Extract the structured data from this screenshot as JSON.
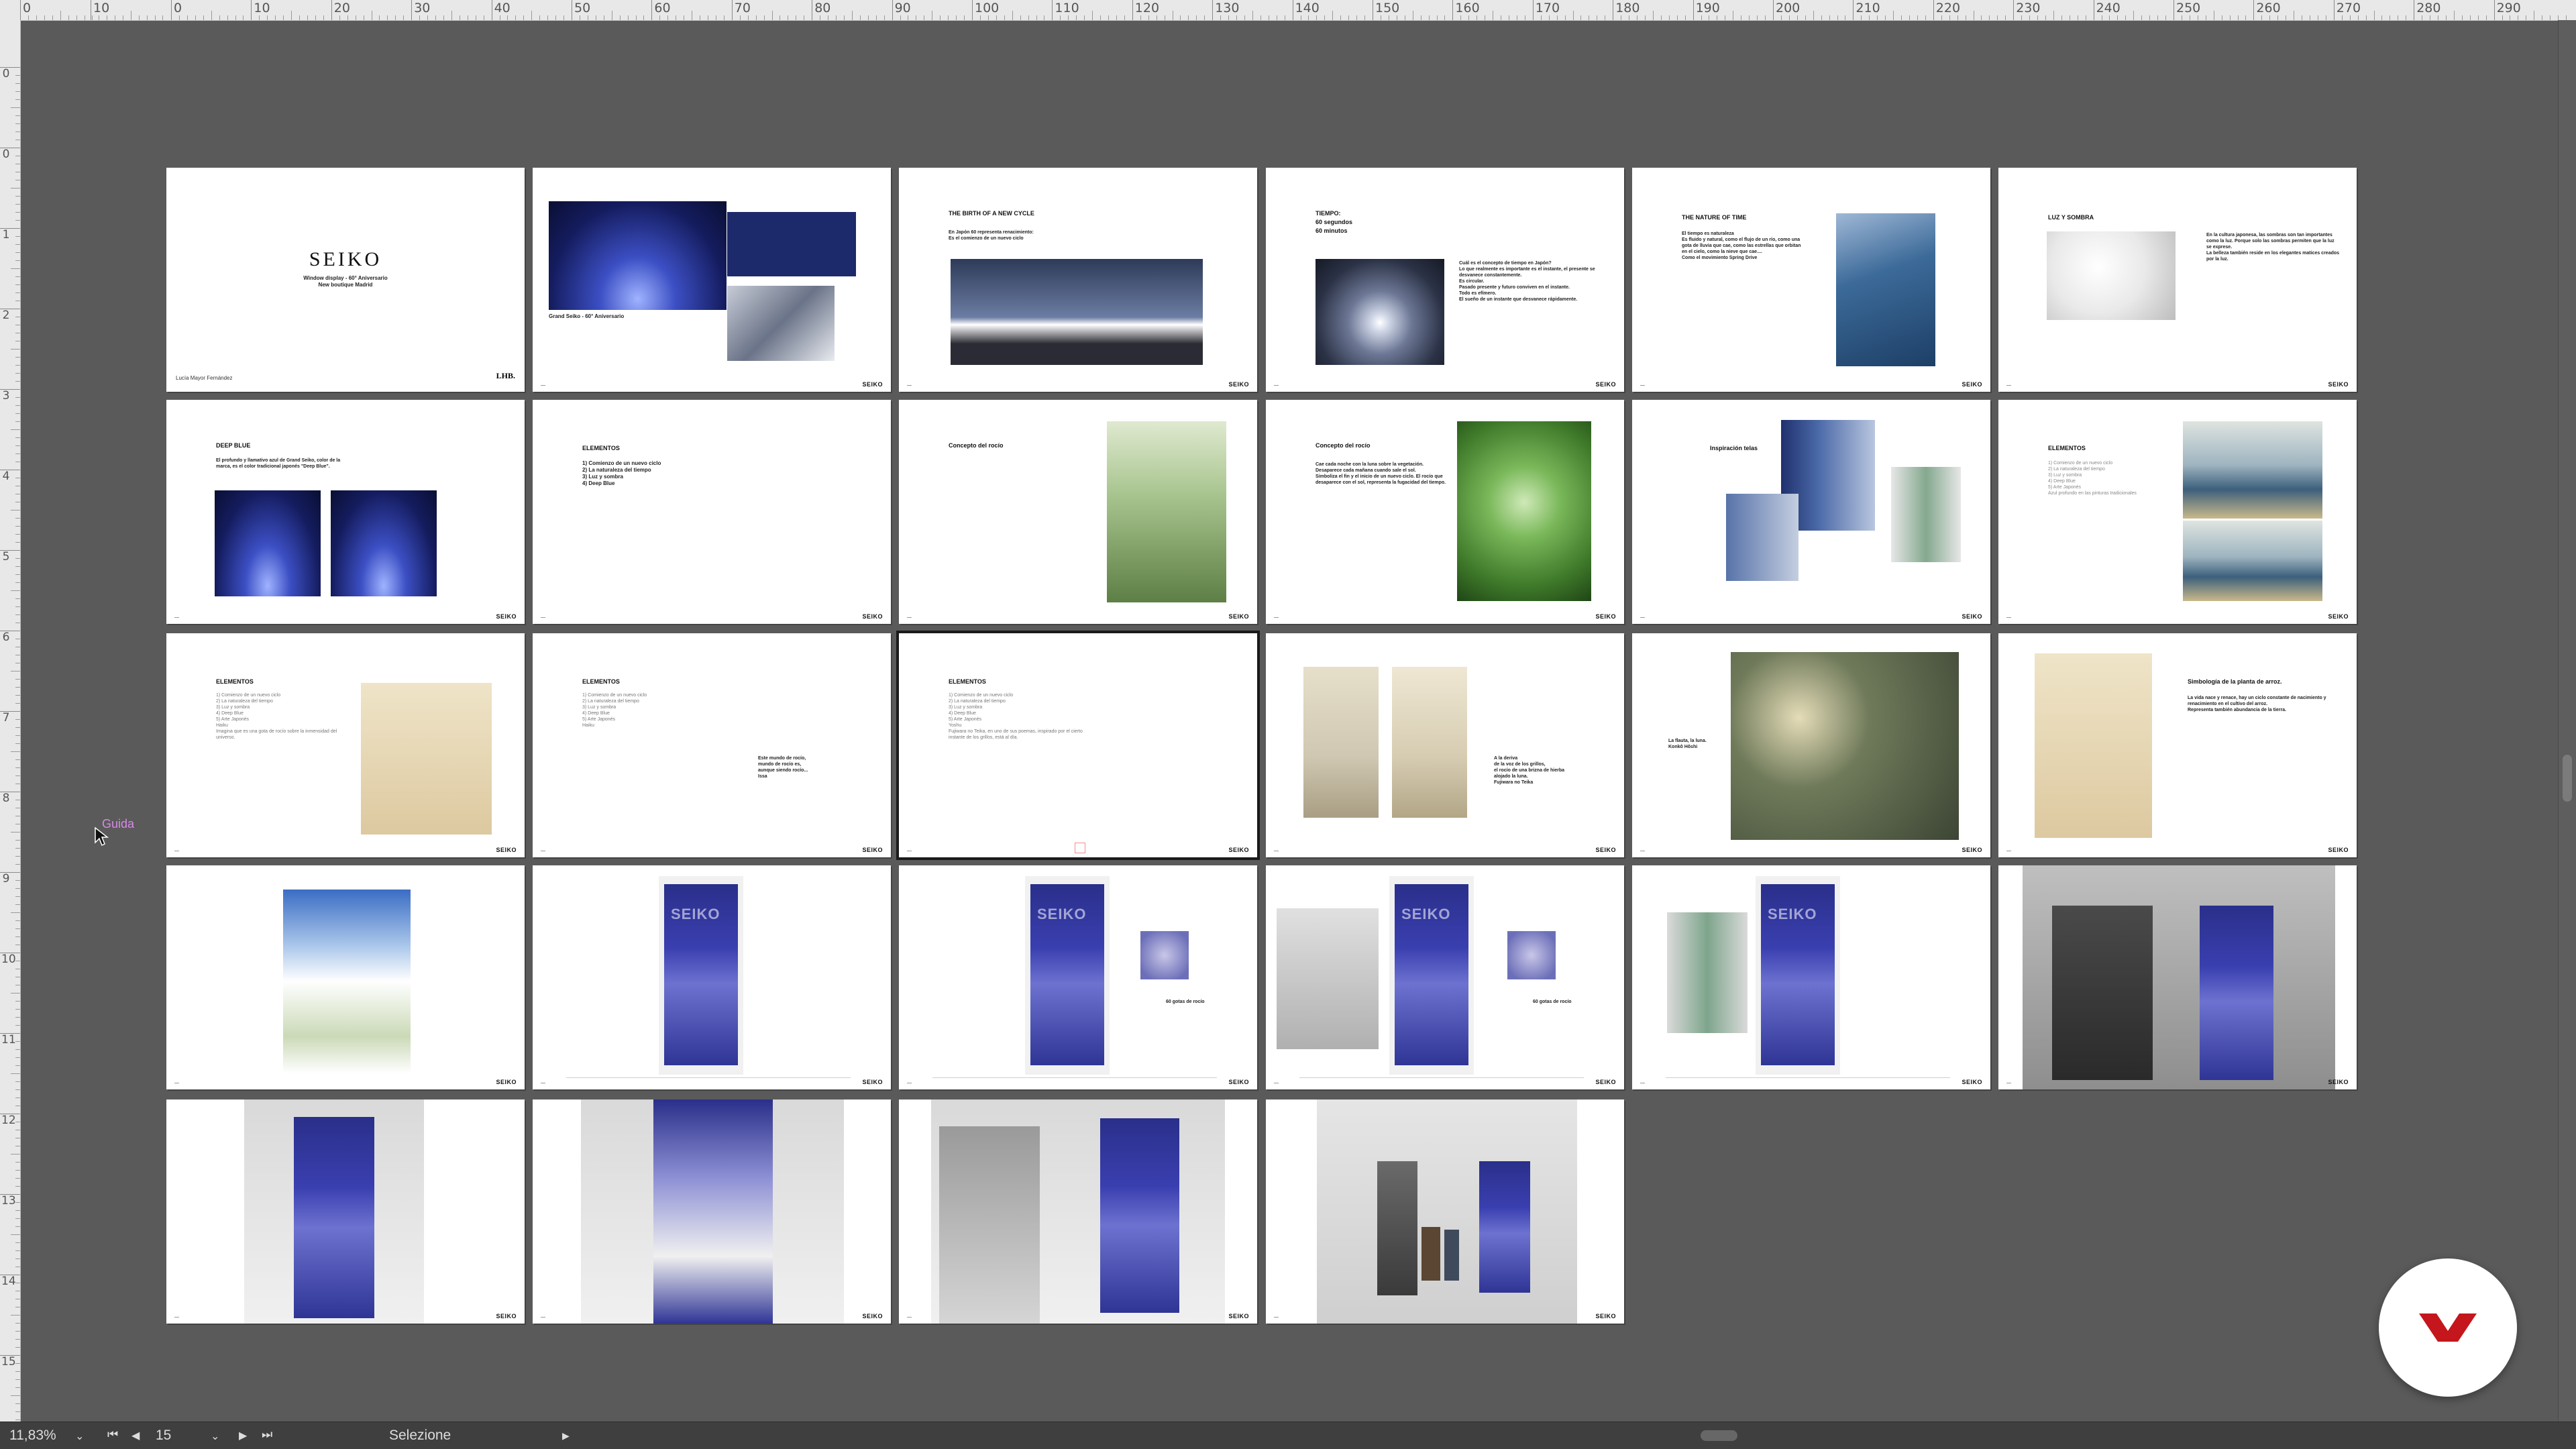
{
  "rulers": {
    "horizontal_labels": [
      "0",
      "10",
      "0",
      "10",
      "20",
      "30",
      "40",
      "50",
      "60",
      "70",
      "80",
      "90",
      "100",
      "110",
      "120",
      "130",
      "140",
      "150",
      "160",
      "170",
      "180",
      "190",
      "200",
      "210",
      "220",
      "230",
      "240",
      "250",
      "260",
      "270",
      "280",
      "290"
    ],
    "vertical_labels": [
      "0",
      "0",
      "1",
      "2",
      "3",
      "4",
      "5",
      "6",
      "7",
      "8",
      "9",
      "10",
      "11",
      "12",
      "13",
      "14",
      "15"
    ]
  },
  "guide_label": "Guida",
  "statusbar": {
    "zoom": "11,83%",
    "page_number": "15",
    "status_text": "Selezione"
  },
  "pages": [
    {
      "title": "SEIKO",
      "subtitle": "Window display - 60° Aniversario\nNew boutique Madrid",
      "footer": "Lucía Mayor Fernández",
      "brand": "LHB."
    },
    {
      "title": "",
      "text": "Grand Seiko - 60° Aniversario",
      "footer": "",
      "brand": "SEIKO"
    },
    {
      "title": "THE BIRTH OF A NEW CYCLE",
      "text": "En Japón 60 representa renacimiento:\nEs el comienzo de un nuevo ciclo",
      "brand": "SEIKO"
    },
    {
      "title": "TIEMPO:\n60 segundos\n60 minutos",
      "text": "Cuál es el concepto de tiempo en Japón?\nLo que realmente es importante es el instante, el presente se desvanece constantemente.\nEs circular.\nPasado presente y futuro conviven en el instante.\nTodo es efímero.\nEl sueño de un instante que desvanece rápidamente.",
      "brand": "SEIKO"
    },
    {
      "title": "THE NATURE OF TIME",
      "text": "El tiempo es naturaleza\nEs fluido y natural, como el flujo de un río, como una gota de lluvia que cae, como las estrellas que orbitan en el cielo, como la nieve que cae....\nComo el movimiento Spring Drive",
      "brand": "SEIKO"
    },
    {
      "title": "LUZ Y SOMBRA",
      "text": "En la cultura japonesa, las sombras son tan importantes como la luz. Porque solo las sombras permiten que la luz se exprese.\nLa belleza también reside en los elegantes matices creados por la luz.",
      "brand": "SEIKO"
    },
    {
      "title": "DEEP BLUE",
      "text": "El profundo y llamativo azul de Grand Seiko, color de la marca, es el color tradicional japonés \"Deep Blue\".",
      "brand": "SEIKO"
    },
    {
      "title": "ELEMENTOS",
      "text": "1) Comienzo de un nuevo ciclo\n2) La naturaleza del tiempo\n3) Luz y sombra\n4) Deep Blue",
      "brand": "SEIKO"
    },
    {
      "title": "Concepto del rocío",
      "text": "",
      "brand": "SEIKO"
    },
    {
      "title": "Concepto del rocío",
      "text": "Cae cada noche con la luna sobre la vegetación. Desaparece cada mañana cuando sale el sol.\nSimboliza el fin y el inicio de un nuevo ciclo. El rocío que desaparece con el sol, representa la fugacidad del tiempo.",
      "brand": "SEIKO"
    },
    {
      "title": "Inspiración telas",
      "text": "",
      "brand": "SEIKO"
    },
    {
      "title": "ELEMENTOS",
      "text": "1) Comienzo de un nuevo ciclo\n2) La naturaleza del tiempo\n3) Luz y sombra\n4) Deep Blue\n5) Arte Japonés\nAzul profundo en las pinturas tradicionales",
      "brand": "SEIKO"
    },
    {
      "title": "ELEMENTOS",
      "text": "1) Comienzo de un nuevo ciclo\n2) La naturaleza del tiempo\n3) Luz y sombra\n4) Deep Blue\n5) Arte Japonés\nHaiku\nImagina que es una gota de rocío sobre la inmensidad del universo.",
      "brand": "SEIKO"
    },
    {
      "title": "ELEMENTOS",
      "text": "1) Comienzo de un nuevo ciclo\n2) La naturaleza del tiempo\n3) Luz y sombra\n4) Deep Blue\n5) Arte Japonés\nHaiku",
      "text2": "Este mundo de rocío,\nmundo de rocío es,\naunque siendo rocío...\nIssa",
      "brand": "SEIKO"
    },
    {
      "title": "ELEMENTOS",
      "text": "1) Comienzo de un nuevo ciclo\n2) La naturaleza del tiempo\n3) Luz y sombra\n4) Deep Blue\n5) Arte Japonés\nYoshu\nFujiwara no Teika, en uno de sus poemas, inspirado por el cierto instante de los grillos, está al día.",
      "brand": "SEIKO"
    },
    {
      "title": "",
      "text": "A la deriva\nde la voz de los grillos,\nel rocío de una brizna de hierba\nalojado la luna.\nFujiwara no Teika",
      "brand": "SEIKO"
    },
    {
      "title": "",
      "text": "La flauta, la luna.\nKonkô Hôshi",
      "brand": "SEIKO"
    },
    {
      "title": "Simbología de la planta de arroz.",
      "text": "La vida nace y renace, hay un ciclo constante de nacimiento y renacimiento en el cultivo del arroz.\nRepresenta también abundancia de la tierra.",
      "brand": "SEIKO"
    },
    {
      "title": "",
      "text": "",
      "brand": "SEIKO"
    },
    {
      "title": "",
      "text": "",
      "brand": "SEIKO"
    },
    {
      "title": "",
      "text": "60 gotas de rocío",
      "brand": "SEIKO"
    },
    {
      "title": "",
      "text": "60 gotas de rocío",
      "brand": "SEIKO"
    },
    {
      "title": "",
      "text": "",
      "brand": "SEIKO"
    },
    {
      "title": "",
      "text": "",
      "brand": "SEIKO"
    },
    {
      "title": "",
      "text": "",
      "brand": "SEIKO"
    },
    {
      "title": "",
      "text": "",
      "brand": "SEIKO"
    },
    {
      "title": "",
      "text": "",
      "brand": "SEIKO"
    },
    {
      "title": "",
      "text": "",
      "brand": "SEIKO"
    }
  ],
  "colors": {
    "pasteboard": "#5a5a5a",
    "ruler": "#e8e8e8",
    "statusbar": "#3f3f3f",
    "badge_red": "#c4161c",
    "seiko_blue": "#2a2f8a"
  }
}
